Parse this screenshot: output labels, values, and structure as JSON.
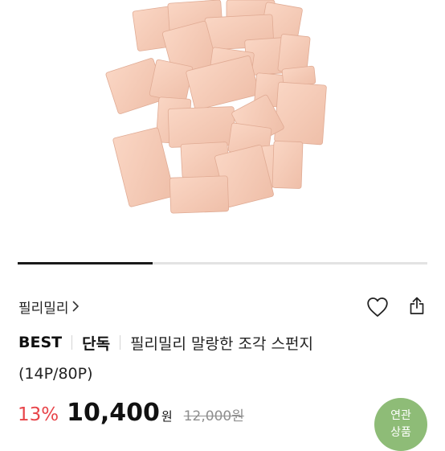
{
  "product": {
    "brand": "필리밀리",
    "tag_best": "BEST",
    "tag_exclusive": "단독",
    "name": "필리밀리 말랑한 조각 스펀지",
    "option": "(14P/80P)",
    "image_alt": "peach colored makeup sponge pieces"
  },
  "carousel": {
    "progress": 0.33
  },
  "pricing": {
    "discount": "13%",
    "price": "10,400",
    "currency": "원",
    "original_price": "12,000원"
  },
  "related_button": {
    "line1": "연관",
    "line2": "상품"
  },
  "icons": {
    "heart": "heart-outline-icon",
    "share": "share-icon",
    "chevron": "chevron-right-icon"
  },
  "colors": {
    "discount": "#e8454a",
    "related_bg": "#8ebc77",
    "sponge": "#f4c9b5"
  }
}
